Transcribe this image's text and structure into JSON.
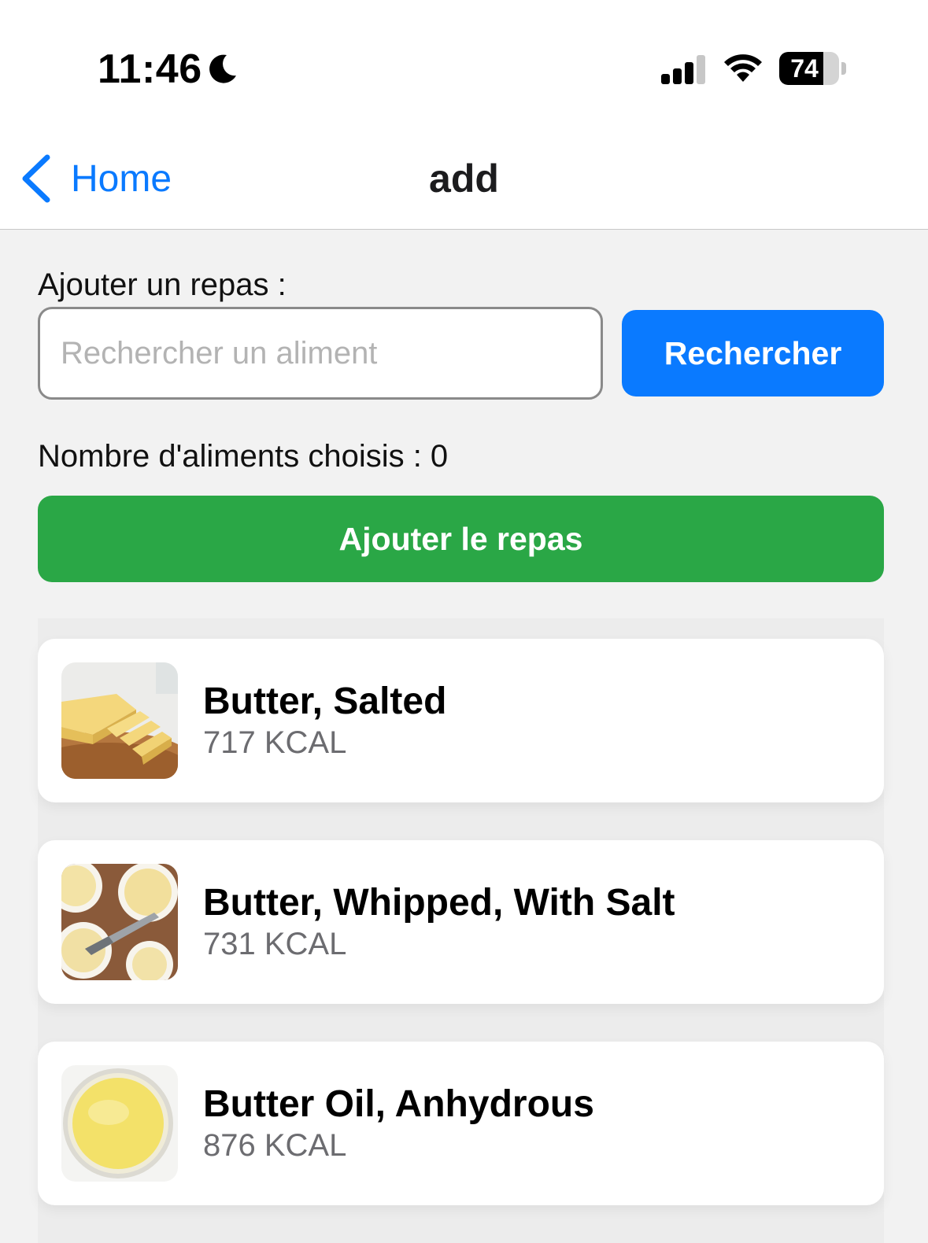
{
  "status_bar": {
    "time": "11:46",
    "battery_level": "74",
    "battery_fraction": 0.74,
    "icons": [
      "moon-icon",
      "signal-icon",
      "wifi-icon",
      "battery-icon"
    ]
  },
  "nav": {
    "back_label": "Home",
    "title": "add"
  },
  "form": {
    "section_label": "Ajouter un repas :",
    "search_placeholder": "Rechercher un aliment",
    "search_value": "",
    "search_button": "Rechercher",
    "count_text": "Nombre d'aliments choisis : 0",
    "add_button": "Ajouter le repas"
  },
  "foods": [
    {
      "name": "Butter, Salted",
      "kcal": "717 KCAL",
      "image": "butter-sticks-photo"
    },
    {
      "name": "Butter, Whipped, With Salt",
      "kcal": "731 KCAL",
      "image": "whipped-butter-photo"
    },
    {
      "name": "Butter Oil, Anhydrous",
      "kcal": "876 KCAL",
      "image": "butter-oil-photo"
    }
  ],
  "colors": {
    "accent_blue": "#0a7aff",
    "success_green": "#2aa746",
    "background": "#f2f2f2",
    "secondary_text": "#6c6c70"
  }
}
